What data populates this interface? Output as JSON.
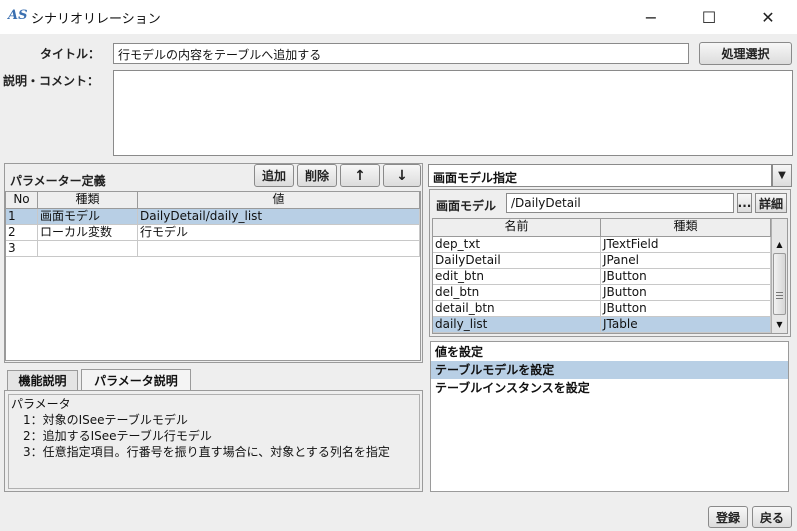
{
  "window": {
    "app_icon": "AS",
    "title": "シナリオリレーション",
    "minimize": "−",
    "maximize": "☐",
    "close": "✕"
  },
  "form": {
    "title_label": "タイトル：",
    "title_value": "行モデルの内容をテーブルへ追加する",
    "select_button": "処理選択",
    "comment_label": "説明・コメント：",
    "comment_value": ""
  },
  "params": {
    "heading": "パラメーター定義",
    "add": "追加",
    "delete": "削除",
    "up": "↑",
    "down": "↓",
    "columns": [
      "No",
      "種類",
      "値"
    ],
    "rows": [
      {
        "no": "1",
        "kind": "画面モデル",
        "value": "DailyDetail/daily_list"
      },
      {
        "no": "2",
        "kind": "ローカル変数",
        "value": "行モデル"
      },
      {
        "no": "3",
        "kind": "",
        "value": ""
      }
    ]
  },
  "tabs": {
    "func": "機能説明",
    "param": "パラメータ説明"
  },
  "description": [
    "パラメータ",
    "　1：対象のISeeテーブルモデル",
    "　2：追加するISeeテーブル行モデル",
    "　3：任意指定項目。行番号を振り直す場合に、対象とする列名を指定"
  ],
  "model": {
    "dropdown": "画面モデル指定",
    "label": "画面モデル",
    "value": "/DailyDetail",
    "browse": "...",
    "detail": "詳細",
    "columns": [
      "名前",
      "種類"
    ],
    "rows": [
      {
        "name": "dep_txt",
        "type": "JTextField"
      },
      {
        "name": "DailyDetail",
        "type": "JPanel"
      },
      {
        "name": "edit_btn",
        "type": "JButton"
      },
      {
        "name": "del_btn",
        "type": "JButton"
      },
      {
        "name": "detail_btn",
        "type": "JButton"
      },
      {
        "name": "daily_list",
        "type": "JTable"
      }
    ]
  },
  "actions": {
    "items": [
      "値を設定",
      "テーブルモデルを設定",
      "テーブルインスタンスを設定"
    ]
  },
  "footer": {
    "register": "登録",
    "back": "戻る"
  },
  "colors": {
    "selection": "#b8cfe5",
    "background": "#eeeeee"
  }
}
